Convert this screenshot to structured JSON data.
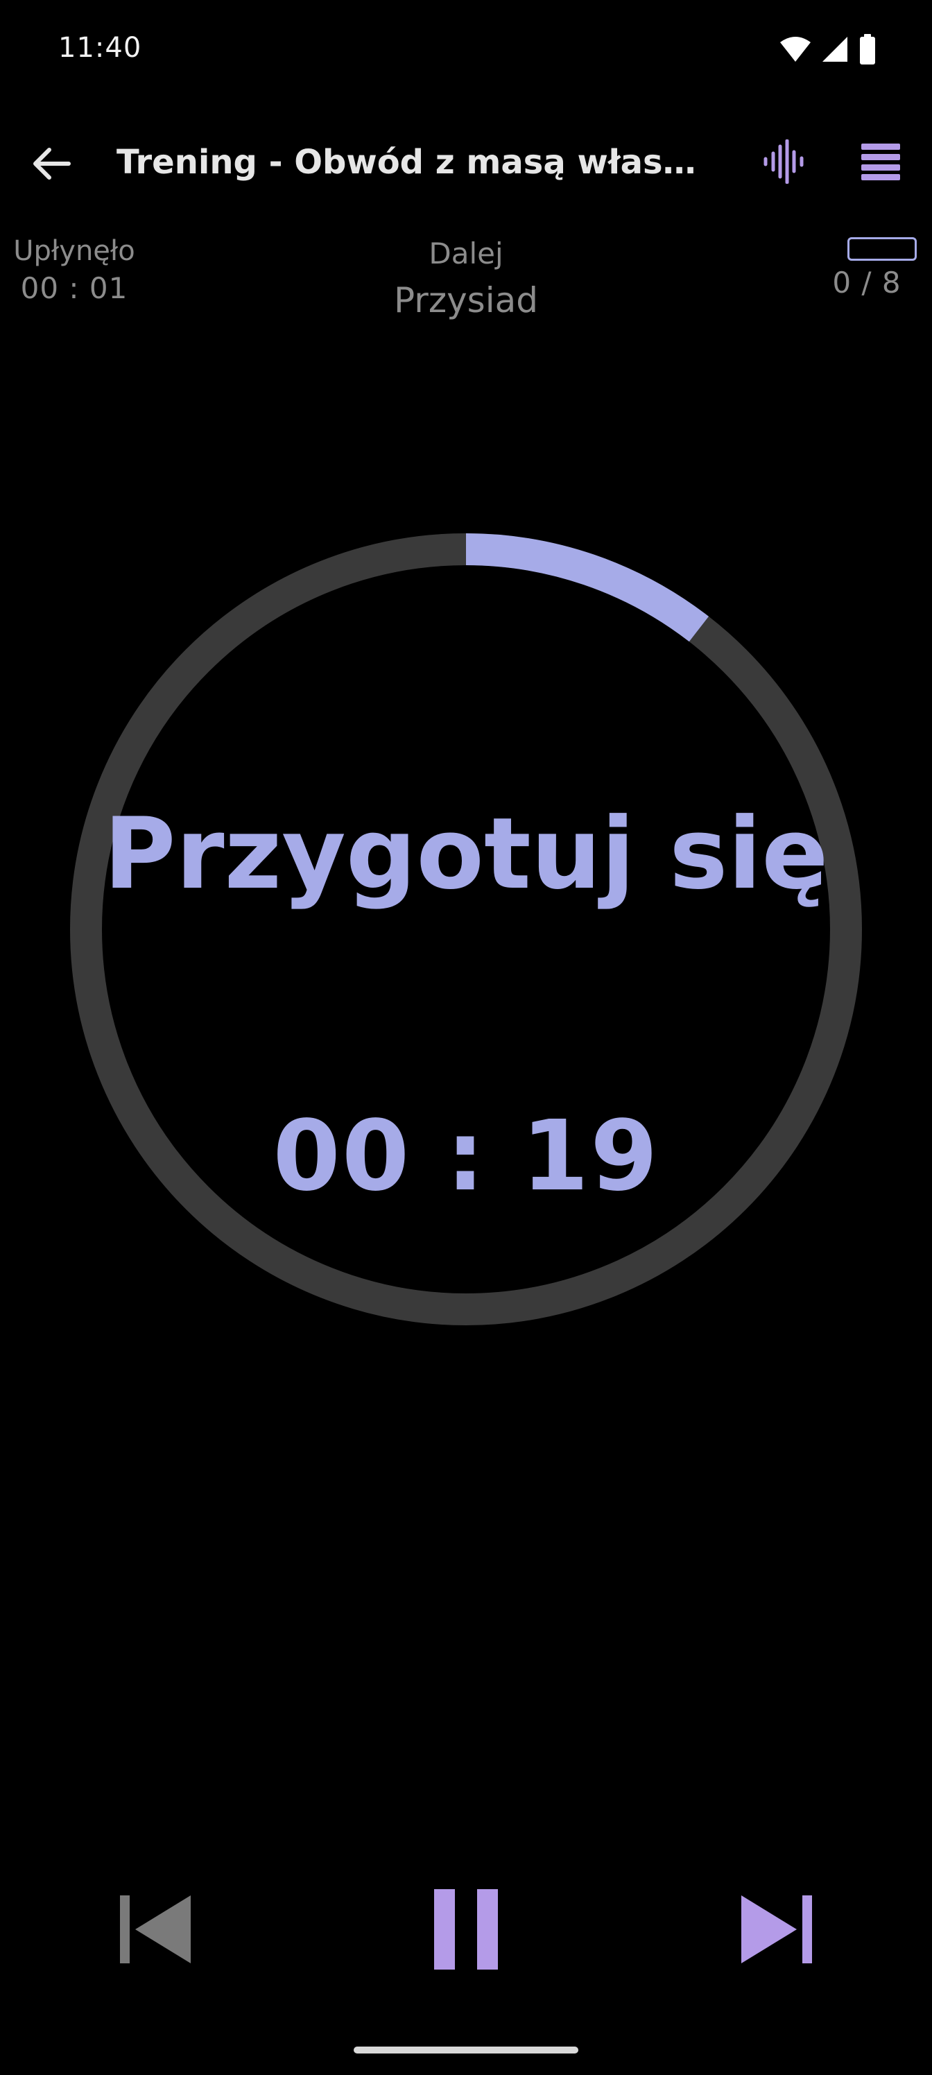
{
  "status_bar": {
    "time": "11:40",
    "icons": [
      "wifi-icon",
      "cellular-signal-icon",
      "battery-icon"
    ]
  },
  "app_bar": {
    "title": "Trening - Obwód z masą własnego ciała",
    "back_icon": "arrow-back-icon",
    "sound_icon": "sound-wave-icon",
    "menu_icon": "list-menu-icon"
  },
  "info": {
    "elapsed_label": "Upłynęło",
    "elapsed_value": "00 : 01",
    "next_label": "Dalej",
    "next_value": "Przysiad",
    "progress_count": "0 / 8",
    "progress_fraction": 0
  },
  "timer": {
    "phase_label": "Przygotuj się",
    "time_remaining": "00 : 19",
    "ring_progress": 0.105
  },
  "controls": {
    "prev_icon": "skip-previous-icon",
    "pause_icon": "pause-icon",
    "next_icon": "skip-next-icon"
  },
  "colors": {
    "background": "#000000",
    "accent": "#a6abe8",
    "icon_accent": "#b49be8",
    "ring_track": "#3a3a3a",
    "muted_text": "#8c8c8c",
    "disabled_icon": "#7a7a7a"
  }
}
